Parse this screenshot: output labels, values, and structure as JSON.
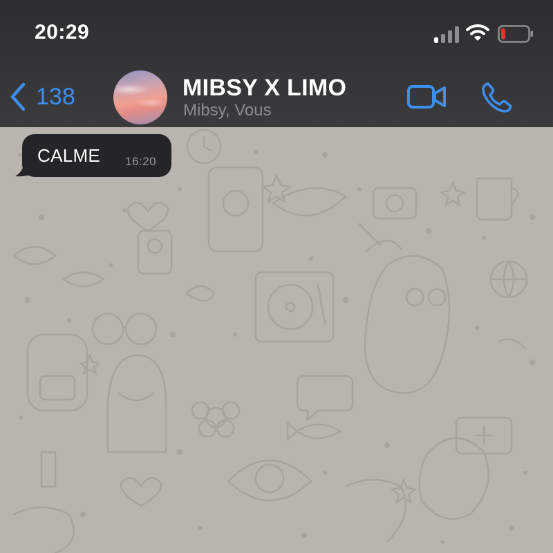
{
  "status_bar": {
    "time": "20:29",
    "signal_bars": 4,
    "signal_bars_active": 1,
    "battery_level": 0.1,
    "battery_color": "#e8332e"
  },
  "header": {
    "back_count": "138",
    "title": "MIBSY X LIMO",
    "subtitle": "Mibsy, Vous",
    "accent_color": "#3d8ff0",
    "icons": [
      "back-chevron-icon",
      "video-camera-icon",
      "phone-icon"
    ]
  },
  "messages": [
    {
      "text": "CALME",
      "time": "16:20",
      "direction": "incoming"
    }
  ],
  "colors": {
    "header_bg": "#3a3a3c",
    "chat_bg": "#b9b4ad",
    "bubble_bg": "#252527"
  }
}
